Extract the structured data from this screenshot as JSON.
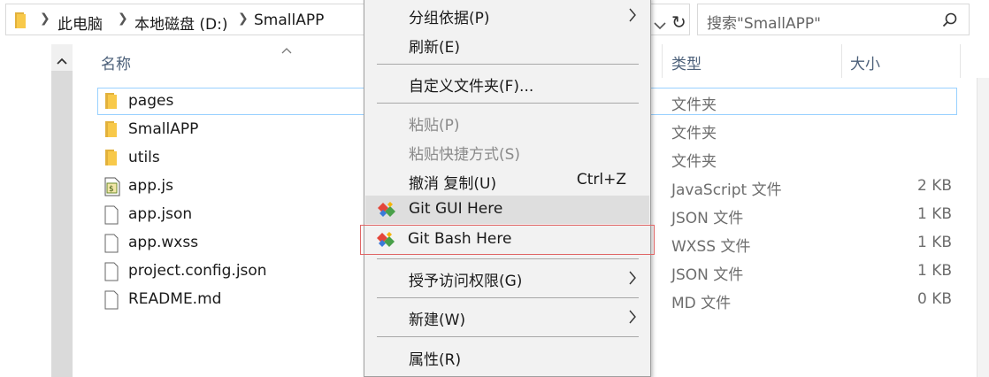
{
  "breadcrumb": {
    "items": [
      "此电脑",
      "本地磁盘 (D:)",
      "SmallAPP"
    ]
  },
  "search": {
    "placeholder": "搜索\"SmallAPP\""
  },
  "columns": {
    "name": "名称",
    "type": "类型",
    "size": "大小"
  },
  "files": [
    {
      "name": "pages",
      "type": "文件夹",
      "size": "",
      "icon": "folder-icon"
    },
    {
      "name": "SmallAPP",
      "type": "文件夹",
      "size": "",
      "icon": "folder-icon"
    },
    {
      "name": "utils",
      "type": "文件夹",
      "size": "",
      "icon": "folder-icon"
    },
    {
      "name": "app.js",
      "type": "JavaScript 文件",
      "size": "2 KB",
      "icon": "js-file-icon"
    },
    {
      "name": "app.json",
      "type": "JSON 文件",
      "size": "1 KB",
      "icon": "file-icon"
    },
    {
      "name": "app.wxss",
      "type": "WXSS 文件",
      "size": "1 KB",
      "icon": "file-icon"
    },
    {
      "name": "project.config.json",
      "type": "JSON 文件",
      "size": "1 KB",
      "icon": "file-icon"
    },
    {
      "name": "README.md",
      "type": "MD 文件",
      "size": "0 KB",
      "icon": "file-icon"
    }
  ],
  "context_menu": {
    "group_by": "分组依据(P)",
    "refresh": "刷新(E)",
    "customize": "自定义文件夹(F)...",
    "paste": "粘贴(P)",
    "paste_shortcut": "粘贴快捷方式(S)",
    "undo_copy": "撤消 复制(U)",
    "undo_copy_shortcut": "Ctrl+Z",
    "git_gui": "Git GUI Here",
    "git_bash": "Git Bash Here",
    "grant_access": "授予访问权限(G)",
    "new": "新建(W)",
    "properties": "属性(R)"
  },
  "colors": {
    "selection_border": "#99d1ff",
    "menu_background": "#f2f2f2",
    "highlight_box": "#e06666",
    "folder_yellow": "#f8c94a"
  }
}
